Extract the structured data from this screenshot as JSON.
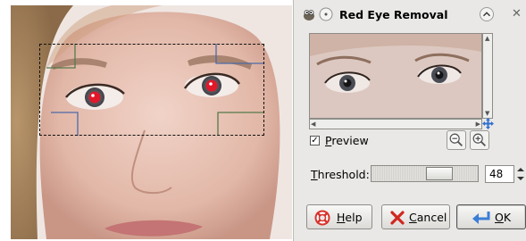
{
  "dialog": {
    "title": "Red Eye Removal",
    "preview_label": "Preview",
    "preview_checked": true,
    "threshold_label": "Threshold:",
    "threshold_value": "48",
    "threshold_fraction": 0.48,
    "buttons": {
      "help": "Help",
      "cancel": "Cancel",
      "ok": "OK"
    }
  },
  "icons": {
    "app": "gimp-wilber-icon",
    "menu": "window-menu-icon",
    "collapse": "chevron-up-icon",
    "close": "close-icon",
    "zoom_out": "zoom-out-icon",
    "zoom_in": "zoom-in-icon",
    "navigate": "move-cross-icon",
    "help": "lifebuoy-icon",
    "cancel": "cancel-x-icon",
    "ok": "return-arrow-icon"
  },
  "colors": {
    "red_eye": "#e0182a",
    "dialog_bg": "#e9e8e6",
    "ok_icon": "#3b7ed6"
  }
}
